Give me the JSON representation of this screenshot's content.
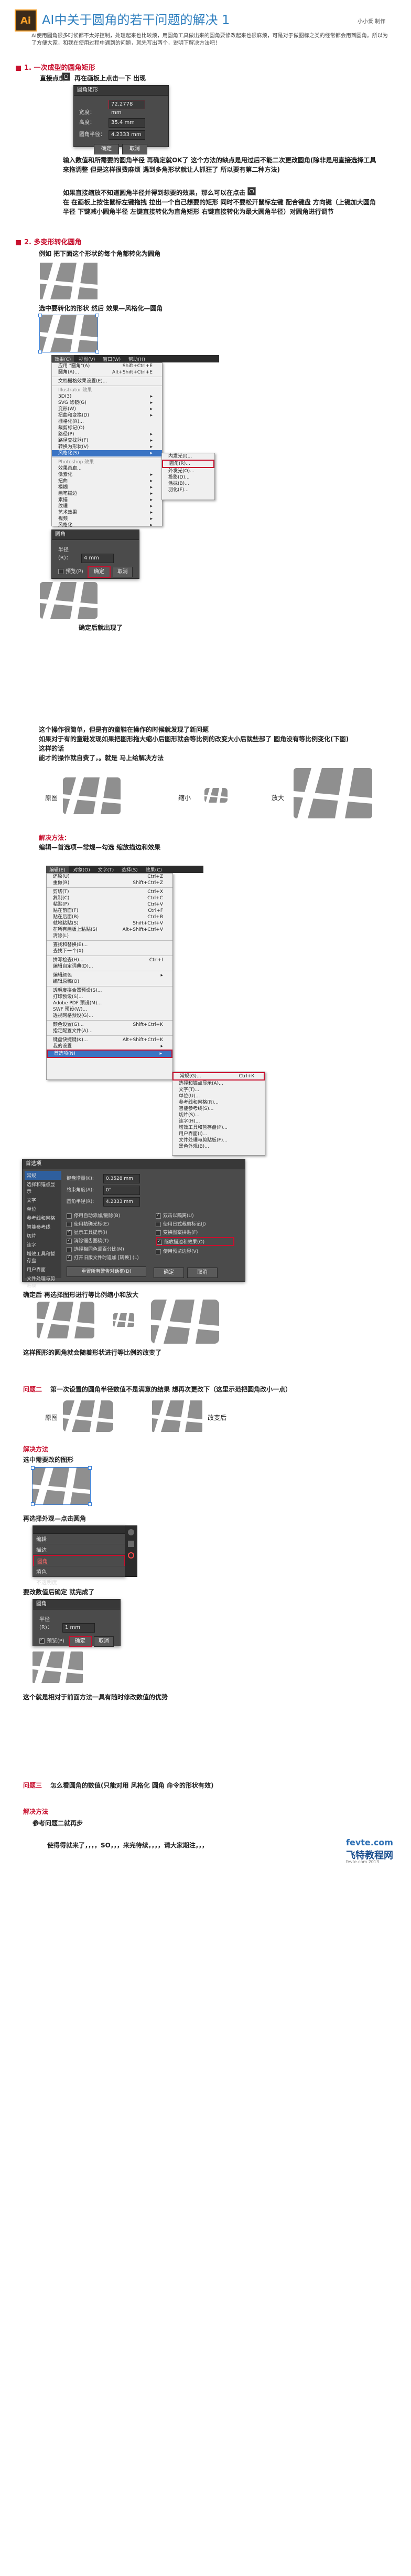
{
  "header": {
    "logo": "Ai",
    "title": "AI中关于圆角的若干问题的解决 1",
    "author": "小小爱 制作",
    "intro": "AI使用圆角很多时候都不太好控制，处理起来也比较烦，用圆角工具做出来的圆角要修改起来也很麻烦，可是对于做图标之类的经常都会用到圆角。所以为了方便大家，和我在使用过程中遇到的问题，就先写出两个，说明下解决方法吧！"
  },
  "section1": {
    "title": "1. 一次成型的圆角矩形",
    "step": "直接点击",
    "step2": "再在画板上点击一下 出现",
    "dialog": {
      "title": "圆角矩形",
      "width_label": "宽度：",
      "width_value": "72.2778 mm",
      "height_label": "高度：",
      "height_value": "35.4 mm",
      "radius_label": "圆角半径：",
      "radius_value": "4.2333 mm",
      "ok": "确定",
      "cancel": "取消"
    },
    "text1": "输入数值和所需要的圆角半径 再确定就OK了 这个方法的缺点是用过后不能二次更改圆角(除非是用直接选择工具来拖调整 但是这样很费麻烦  遇到多角形状就让人抓狂了 所以要有第二种方法)",
    "text2": "如果直接缩放不知道圆角半径并得到想要的效果，那么可以在点击",
    "text3": "在 在画板上按住鼠标左键拖拽 拉出一个自己想要的矩形  同时不要松开鼠标左键 配合键盘 方向键（上键加大圆角半径 下键减小圆角半径 左键直接转化为直角矩形  右键直接转化为最大圆角半径）对圆角进行调节"
  },
  "section2": {
    "title": "2. 多变形转化圆角",
    "line1": "例如 把下面这个形状的每个角都转化为圆角",
    "line2": "选中要转化的形状  然后 效果—风格化—圆角",
    "menu_bar": [
      "效果(C)",
      "视图(V)",
      "窗口(W)",
      "帮助(H)"
    ],
    "menu1": [
      {
        "label": "应用 \"圆角\"(A)",
        "sc": "Shift+Ctrl+E"
      },
      {
        "label": "圆角(A)...",
        "sc": "Alt+Shift+Ctrl+E"
      },
      {
        "label": "文档栅格效果设置(E)...",
        "sc": ""
      },
      {
        "label": "Illustrator 效果",
        "sc": ""
      },
      {
        "label": "3D(3)",
        "sc": ""
      },
      {
        "label": "SVG 滤镜(G)",
        "sc": ""
      },
      {
        "label": "变形(W)",
        "sc": ""
      },
      {
        "label": "扭曲和变换(D)",
        "sc": ""
      },
      {
        "label": "栅格化(R)...",
        "sc": ""
      },
      {
        "label": "裁剪标记(O)",
        "sc": ""
      },
      {
        "label": "路径(P)",
        "sc": ""
      },
      {
        "label": "路径查找器(F)",
        "sc": ""
      },
      {
        "label": "转换为形状(V)",
        "sc": ""
      },
      {
        "label": "风格化(S)",
        "sc": ""
      },
      {
        "label": "Photoshop 效果",
        "sc": ""
      },
      {
        "label": "效果画廊...",
        "sc": ""
      },
      {
        "label": "像素化",
        "sc": ""
      },
      {
        "label": "扭曲",
        "sc": ""
      },
      {
        "label": "模糊",
        "sc": ""
      },
      {
        "label": "画笔描边",
        "sc": ""
      },
      {
        "label": "素描",
        "sc": ""
      },
      {
        "label": "纹理",
        "sc": ""
      },
      {
        "label": "艺术效果",
        "sc": ""
      },
      {
        "label": "视频",
        "sc": ""
      },
      {
        "label": "风格化",
        "sc": ""
      }
    ],
    "submenu1": [
      "内发光(I)...",
      "圆角(R)...",
      "外发光(O)...",
      "投影(D)...",
      "涂抹(B)...",
      "羽化(F)..."
    ],
    "round_dialog": {
      "title": "圆角",
      "radius_label": "半径(R)：",
      "radius_value": "4 mm",
      "preview": "预览(P)",
      "ok": "确定",
      "cancel": "取消"
    },
    "line3": "确定后就出现了",
    "line4": "这个操作很简单，但是有的童鞋在操作的时候就发现了新问题",
    "line5": "编辑—首选项—常规—勾选 缩放描边和效果",
    "line6": "能才的操作就自费了，。就是 马上给解决方法",
    "line4b": "如果对于有的童鞋发现如果把图形拖大缩小后图形就会等比例的改变大小后就些部了 圆角没有等比例变化(下图)",
    "line4c": "这样的话",
    "orig": "原图",
    "shrink": "缩小",
    "enlarge": "放大",
    "solution_title": "解决方法：",
    "solution": "编辑—首选项—常规—勾选 缩放描边和效果",
    "menu_bar2": [
      "编辑(E)",
      "对象(O)",
      "文字(T)",
      "选择(S)",
      "效果(C)"
    ],
    "menu2": [
      {
        "label": "还原(U)",
        "sc": "Ctrl+Z"
      },
      {
        "label": "重做(R)",
        "sc": "Shift+Ctrl+Z"
      },
      {
        "label": "剪切(T)",
        "sc": "Ctrl+X"
      },
      {
        "label": "复制(C)",
        "sc": "Ctrl+C"
      },
      {
        "label": "粘贴(P)",
        "sc": "Ctrl+V"
      },
      {
        "label": "贴在前面(F)",
        "sc": "Ctrl+F"
      },
      {
        "label": "贴在后面(B)",
        "sc": "Ctrl+B"
      },
      {
        "label": "就地粘贴(S)",
        "sc": "Shift+Ctrl+V"
      },
      {
        "label": "在所有画板上粘贴(S)",
        "sc": "Alt+Shift+Ctrl+V"
      },
      {
        "label": "清除(L)",
        "sc": ""
      },
      {
        "label": "查找和替换(E)...",
        "sc": ""
      },
      {
        "label": "查找下一个(X)",
        "sc": ""
      },
      {
        "label": "拼写检查(H)...",
        "sc": "Ctrl+I"
      },
      {
        "label": "编辑自定词典(D)...",
        "sc": ""
      },
      {
        "label": "编辑颜色",
        "sc": ""
      },
      {
        "label": "编辑原稿(O)",
        "sc": ""
      },
      {
        "label": "透明度拼合器预设(S)...",
        "sc": ""
      },
      {
        "label": "打印预设(S)...",
        "sc": ""
      },
      {
        "label": "Adobe PDF 预设(M)...",
        "sc": ""
      },
      {
        "label": "SWF 预设(W)...",
        "sc": ""
      },
      {
        "label": "透视网格预设(G)...",
        "sc": ""
      },
      {
        "label": "颜色设置(G)...",
        "sc": "Shift+Ctrl+K"
      },
      {
        "label": "指定配置文件(A)...",
        "sc": ""
      },
      {
        "label": "键盘快捷键(K)...",
        "sc": "Alt+Shift+Ctrl+K"
      },
      {
        "label": "我的设置",
        "sc": ""
      },
      {
        "label": "首选项(N)",
        "sc": ""
      }
    ],
    "submenu2": [
      {
        "label": "常规(G)...",
        "sc": "Ctrl+K"
      },
      {
        "label": "选择和锚点显示(A)...",
        "sc": ""
      },
      {
        "label": "文字(T)...",
        "sc": ""
      },
      {
        "label": "单位(U)...",
        "sc": ""
      },
      {
        "label": "参考线和网格(R)...",
        "sc": ""
      },
      {
        "label": "智能参考线(S)...",
        "sc": ""
      },
      {
        "label": "切片(S)...",
        "sc": ""
      },
      {
        "label": "连字(H)...",
        "sc": ""
      },
      {
        "label": "增效工具和暂存盘(P)...",
        "sc": ""
      },
      {
        "label": "用户界面(I)...",
        "sc": ""
      },
      {
        "label": "文件处理与剪贴板(F)...",
        "sc": ""
      },
      {
        "label": "黑色外观(B)...",
        "sc": ""
      }
    ]
  },
  "prefs": {
    "title": "首选项",
    "sidebar": [
      "常规",
      "选择和锚点显示",
      "文字",
      "单位",
      "参考线和网格",
      "智能参考线",
      "切片",
      "连字",
      "增效工具和暂存盘",
      "用户界面",
      "文件处理与剪贴板",
      "黑色外观"
    ],
    "key_label": "键盘增量(K):",
    "key_value": "0.3528 mm",
    "angle_label": "约束角度(A):",
    "angle_value": "0°",
    "radius_label": "圆角半径(R):",
    "radius_value": "4.2333 mm",
    "left_checks": [
      {
        "label": "停用自动添加/删除(B)",
        "on": false
      },
      {
        "label": "使用精确光标(E)",
        "on": false
      },
      {
        "label": "显示工具提示(I)",
        "on": true
      },
      {
        "label": "消除锯齿图稿(T)",
        "on": true
      },
      {
        "label": "选择相同色调百分比(M)",
        "on": false
      },
      {
        "label": "打开旧版文件时追加 [转换] (L)",
        "on": true
      }
    ],
    "right_checks": [
      {
        "label": "双击以隔离(U)",
        "on": true
      },
      {
        "label": "使用日式裁剪标记(J)",
        "on": false
      },
      {
        "label": "变换图案拼贴(F)",
        "on": false
      },
      {
        "label": "缩放描边和效果(O)",
        "on": true
      },
      {
        "label": "使用预览边界(V)",
        "on": false
      }
    ],
    "reset": "重置所有警告对话框(D)",
    "ok": "确定",
    "cancel": "取消"
  },
  "section3": {
    "line1": "确定后 再选择图形进行等比例缩小和放大",
    "line2": "这样图形的圆角就会随着形状进行等比例的改变了",
    "issue_title": "问题二",
    "issue_text": "第一次设置的圆角半径数值不是满意的结果 想再次更改下（这里示范把圆角改小一点）",
    "orig": "原图",
    "changed": "改变后",
    "solution_title": "解决方法",
    "step1": "选中需要改的图形",
    "step2": "再选择外观—点击圆角",
    "appearance_rows": [
      "编辑",
      "描边",
      "圆角",
      "填色",
      "不透明度",
      "默认值"
    ],
    "step3": "要改数值后确定 就完成了",
    "round_dialog2": {
      "title": "圆角",
      "radius_label": "半径(R)：",
      "radius_value": "1 mm",
      "preview": "预览(P)",
      "ok": "确定",
      "cancel": "取消"
    },
    "line3": "这个就是相对于前面方法一具有随时修改数值的优势"
  },
  "section4": {
    "issue_title": "问题三",
    "issue_text": "怎么看圆角的数值(只能对用 风格化 圆角 命令的形状有效)",
    "solution_title": "解决方法",
    "ref": "参考问题二就再步",
    "footer": "使得得就来了，，，，SO，，，来完待续，，，，请大家期注，，，",
    "brand": "飞特教程网",
    "brand_url": "fevte.com",
    "site_small": "fevte.com 2013"
  }
}
